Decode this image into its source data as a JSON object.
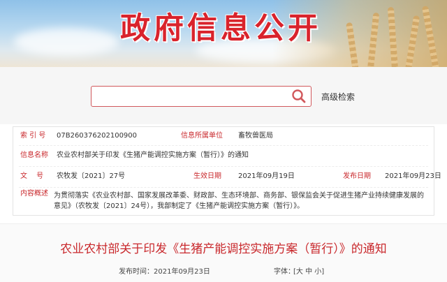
{
  "banner": {
    "title": "政府信息公开"
  },
  "search": {
    "placeholder": "",
    "advanced_label": "高级检索"
  },
  "info": {
    "index_label": "索 引 号",
    "index_value": "07B260376202100900",
    "org_label": "信息所属单位",
    "org_value": "畜牧兽医局",
    "name_label": "信息名称",
    "name_value": "农业农村部关于印发《生猪产能调控实施方案（暂行）》的通知",
    "doc_label": "文　 号",
    "doc_value": "农牧发〔2021〕27号",
    "effective_label": "生效日期",
    "effective_value": "2021年09月19日",
    "publish_label": "发布日期",
    "publish_value": "2021年09月23日",
    "summary_label": "内容概述",
    "summary_value": "为贯彻落实《农业农村部、国家发展改革委、财政部、生态环境部、商务部、银保监会关于促进生猪产业持续健康发展的意见》（农牧发〔2021〕24号），我部制定了《生猪产能调控实施方案（暂行）》。"
  },
  "article": {
    "title": "农业农村部关于印发《生猪产能调控实施方案（暂行）》的通知",
    "publish_time_label": "发布时间：2021年09月23日",
    "font_label": "字体：",
    "font_sizes": "[大 中 小]"
  },
  "colors": {
    "brand_red": "#c9292d",
    "search_border": "#d1585c"
  },
  "icons": {
    "search": "magnifier-icon"
  }
}
